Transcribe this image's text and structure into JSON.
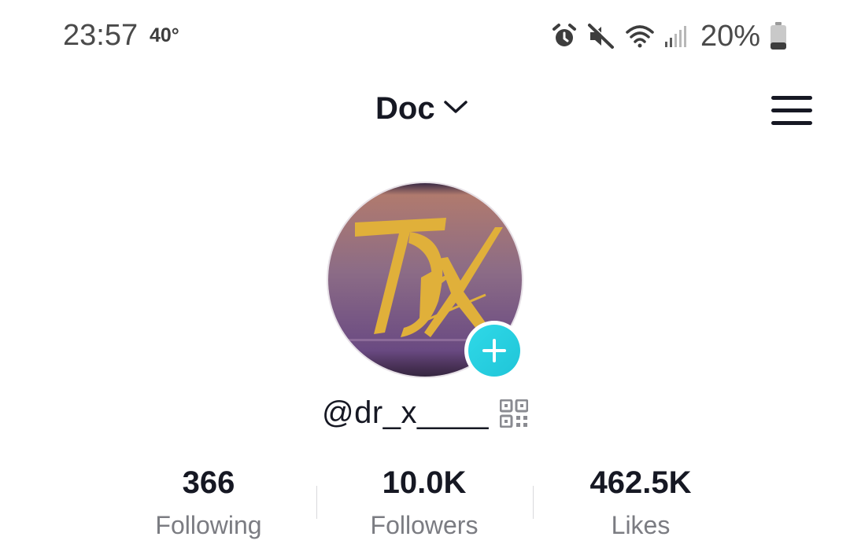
{
  "status_bar": {
    "time": "23:57",
    "temperature": "40°",
    "battery_percent": "20%",
    "icons": [
      "alarm-icon",
      "mute-icon",
      "wifi-icon",
      "signal-icon",
      "battery-icon"
    ]
  },
  "header": {
    "account_name": "Doc",
    "account_switch_icon": "chevron-down-icon",
    "menu_icon": "hamburger-menu-icon"
  },
  "profile": {
    "avatar_text": "DrX",
    "add_icon": "plus-icon",
    "username": "@dr_x____",
    "qr_icon": "qr-code-icon"
  },
  "stats": [
    {
      "value": "366",
      "label": "Following"
    },
    {
      "value": "10.0K",
      "label": "Followers"
    },
    {
      "value": "462.5K",
      "label": "Likes"
    }
  ],
  "colors": {
    "text_primary": "#161823",
    "text_secondary": "#7b7c82",
    "accent_teal": "#20c5d8",
    "avatar_logo_gold": "#e0b03a",
    "avatar_bg_purple": "#7a5a8a"
  }
}
